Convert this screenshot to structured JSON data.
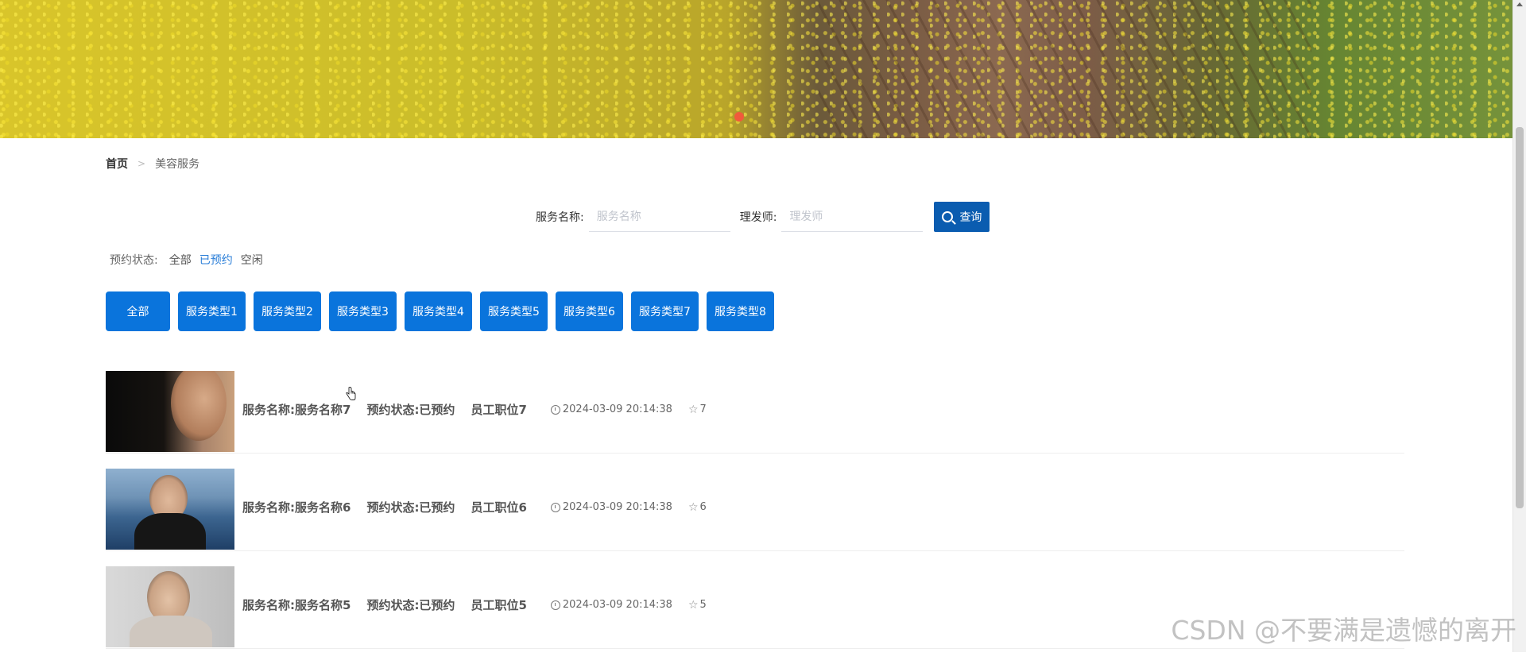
{
  "breadcrumb": {
    "home": "首页",
    "separator": ">",
    "current": "美容服务"
  },
  "search": {
    "service_label": "服务名称:",
    "service_placeholder": "服务名称",
    "barber_label": "理发师:",
    "barber_placeholder": "理发师",
    "button_label": "查询"
  },
  "status_filter": {
    "label": "预约状态:",
    "options": [
      "全部",
      "已预约",
      "空闲"
    ],
    "active": "已预约"
  },
  "service_types": [
    "全部",
    "服务类型1",
    "服务类型2",
    "服务类型3",
    "服务类型4",
    "服务类型5",
    "服务类型6",
    "服务类型7",
    "服务类型8"
  ],
  "items": [
    {
      "name": "服务名称:服务名称7",
      "status": "预约状态:已预约",
      "position": "员工职位7",
      "time": "2024-03-09 20:14:38",
      "count": "7"
    },
    {
      "name": "服务名称:服务名称6",
      "status": "预约状态:已预约",
      "position": "员工职位6",
      "time": "2024-03-09 20:14:38",
      "count": "6"
    },
    {
      "name": "服务名称:服务名称5",
      "status": "预约状态:已预约",
      "position": "员工职位5",
      "time": "2024-03-09 20:14:38",
      "count": "5"
    }
  ],
  "watermark": "CSDN @不要满是遗憾的离开",
  "colors": {
    "primary": "#0a74dc",
    "search_button": "#0a5cb0",
    "active_link": "#2a7ed8"
  }
}
